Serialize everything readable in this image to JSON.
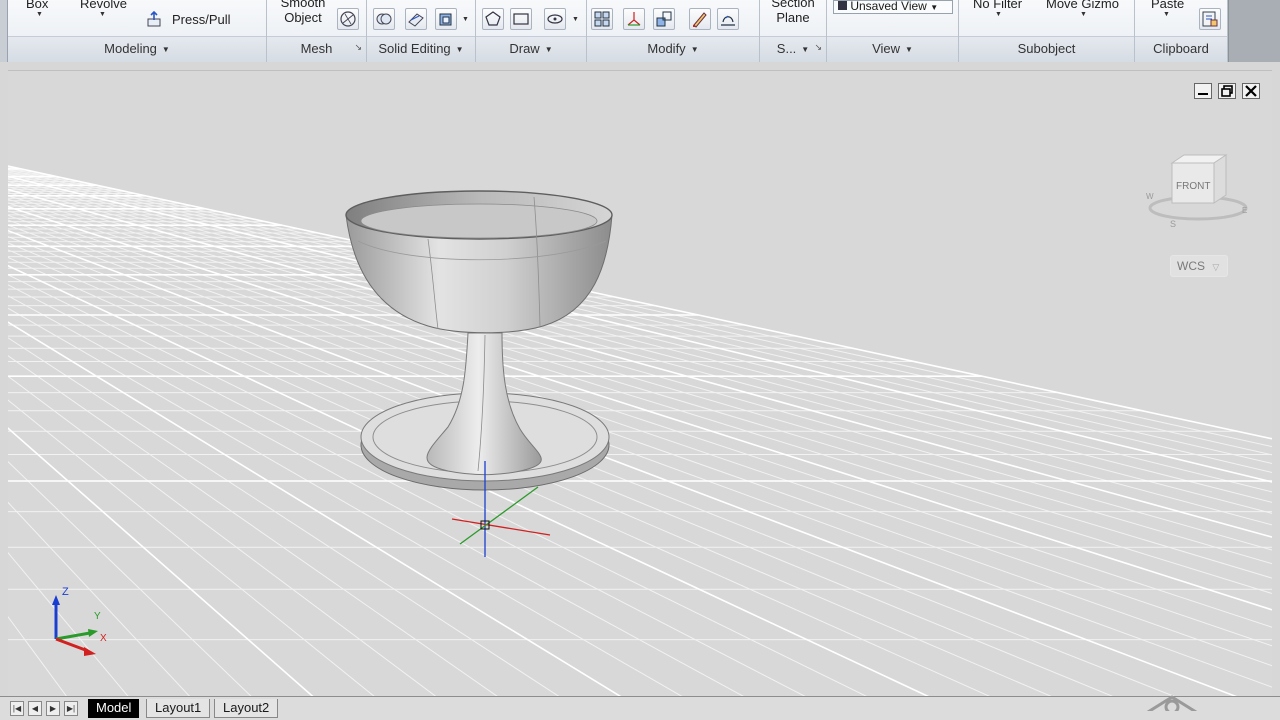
{
  "ribbon": {
    "panels": [
      {
        "title": "Modeling"
      },
      {
        "title": "Mesh"
      },
      {
        "title": "Solid Editing"
      },
      {
        "title": "Draw"
      },
      {
        "title": "Modify"
      },
      {
        "title": "S..."
      },
      {
        "title": "View"
      },
      {
        "title": "Subobject"
      },
      {
        "title": "Clipboard"
      }
    ],
    "commands": {
      "box": "Box",
      "revolve": "Revolve",
      "press_pull": "Press/Pull",
      "smooth_object_line1": "Smooth",
      "smooth_object_line2": "Object",
      "section_plane_line1": "Section",
      "section_plane_line2": "Plane",
      "unsaved_view": "Unsaved View",
      "no_filter": "No Filter",
      "move_gizmo": "Move Gizmo",
      "paste": "Paste"
    }
  },
  "viewcube": {
    "face_label": "FRONT",
    "compass_s": "S",
    "compass_w": "W",
    "compass_e": "E"
  },
  "wcs_menu": {
    "label": "WCS"
  },
  "ucs_icon": {
    "x": "X",
    "y": "Y",
    "z": "Z"
  },
  "tabs": [
    {
      "label": "Model",
      "active": true
    },
    {
      "label": "Layout1",
      "active": false
    },
    {
      "label": "Layout2",
      "active": false
    }
  ],
  "colors": {
    "viewport_bg": "#d8d8d8",
    "ribbon_bg": "#eef1f5",
    "x_axis": "#d22020",
    "y_axis": "#2a9a2a",
    "z_axis": "#1a3fd0"
  }
}
